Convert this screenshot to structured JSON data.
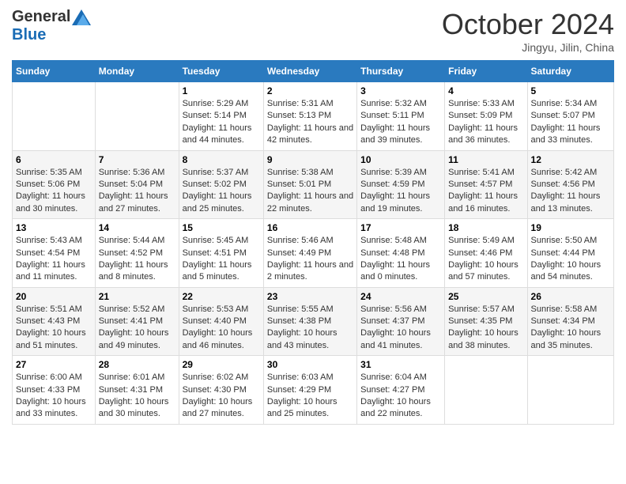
{
  "header": {
    "logo_general": "General",
    "logo_blue": "Blue",
    "month_title": "October 2024",
    "location": "Jingyu, Jilin, China"
  },
  "weekdays": [
    "Sunday",
    "Monday",
    "Tuesday",
    "Wednesday",
    "Thursday",
    "Friday",
    "Saturday"
  ],
  "weeks": [
    [
      {
        "day": "",
        "info": ""
      },
      {
        "day": "",
        "info": ""
      },
      {
        "day": "1",
        "sunrise": "Sunrise: 5:29 AM",
        "sunset": "Sunset: 5:14 PM",
        "daylight": "Daylight: 11 hours and 44 minutes."
      },
      {
        "day": "2",
        "sunrise": "Sunrise: 5:31 AM",
        "sunset": "Sunset: 5:13 PM",
        "daylight": "Daylight: 11 hours and 42 minutes."
      },
      {
        "day": "3",
        "sunrise": "Sunrise: 5:32 AM",
        "sunset": "Sunset: 5:11 PM",
        "daylight": "Daylight: 11 hours and 39 minutes."
      },
      {
        "day": "4",
        "sunrise": "Sunrise: 5:33 AM",
        "sunset": "Sunset: 5:09 PM",
        "daylight": "Daylight: 11 hours and 36 minutes."
      },
      {
        "day": "5",
        "sunrise": "Sunrise: 5:34 AM",
        "sunset": "Sunset: 5:07 PM",
        "daylight": "Daylight: 11 hours and 33 minutes."
      }
    ],
    [
      {
        "day": "6",
        "sunrise": "Sunrise: 5:35 AM",
        "sunset": "Sunset: 5:06 PM",
        "daylight": "Daylight: 11 hours and 30 minutes."
      },
      {
        "day": "7",
        "sunrise": "Sunrise: 5:36 AM",
        "sunset": "Sunset: 5:04 PM",
        "daylight": "Daylight: 11 hours and 27 minutes."
      },
      {
        "day": "8",
        "sunrise": "Sunrise: 5:37 AM",
        "sunset": "Sunset: 5:02 PM",
        "daylight": "Daylight: 11 hours and 25 minutes."
      },
      {
        "day": "9",
        "sunrise": "Sunrise: 5:38 AM",
        "sunset": "Sunset: 5:01 PM",
        "daylight": "Daylight: 11 hours and 22 minutes."
      },
      {
        "day": "10",
        "sunrise": "Sunrise: 5:39 AM",
        "sunset": "Sunset: 4:59 PM",
        "daylight": "Daylight: 11 hours and 19 minutes."
      },
      {
        "day": "11",
        "sunrise": "Sunrise: 5:41 AM",
        "sunset": "Sunset: 4:57 PM",
        "daylight": "Daylight: 11 hours and 16 minutes."
      },
      {
        "day": "12",
        "sunrise": "Sunrise: 5:42 AM",
        "sunset": "Sunset: 4:56 PM",
        "daylight": "Daylight: 11 hours and 13 minutes."
      }
    ],
    [
      {
        "day": "13",
        "sunrise": "Sunrise: 5:43 AM",
        "sunset": "Sunset: 4:54 PM",
        "daylight": "Daylight: 11 hours and 11 minutes."
      },
      {
        "day": "14",
        "sunrise": "Sunrise: 5:44 AM",
        "sunset": "Sunset: 4:52 PM",
        "daylight": "Daylight: 11 hours and 8 minutes."
      },
      {
        "day": "15",
        "sunrise": "Sunrise: 5:45 AM",
        "sunset": "Sunset: 4:51 PM",
        "daylight": "Daylight: 11 hours and 5 minutes."
      },
      {
        "day": "16",
        "sunrise": "Sunrise: 5:46 AM",
        "sunset": "Sunset: 4:49 PM",
        "daylight": "Daylight: 11 hours and 2 minutes."
      },
      {
        "day": "17",
        "sunrise": "Sunrise: 5:48 AM",
        "sunset": "Sunset: 4:48 PM",
        "daylight": "Daylight: 11 hours and 0 minutes."
      },
      {
        "day": "18",
        "sunrise": "Sunrise: 5:49 AM",
        "sunset": "Sunset: 4:46 PM",
        "daylight": "Daylight: 10 hours and 57 minutes."
      },
      {
        "day": "19",
        "sunrise": "Sunrise: 5:50 AM",
        "sunset": "Sunset: 4:44 PM",
        "daylight": "Daylight: 10 hours and 54 minutes."
      }
    ],
    [
      {
        "day": "20",
        "sunrise": "Sunrise: 5:51 AM",
        "sunset": "Sunset: 4:43 PM",
        "daylight": "Daylight: 10 hours and 51 minutes."
      },
      {
        "day": "21",
        "sunrise": "Sunrise: 5:52 AM",
        "sunset": "Sunset: 4:41 PM",
        "daylight": "Daylight: 10 hours and 49 minutes."
      },
      {
        "day": "22",
        "sunrise": "Sunrise: 5:53 AM",
        "sunset": "Sunset: 4:40 PM",
        "daylight": "Daylight: 10 hours and 46 minutes."
      },
      {
        "day": "23",
        "sunrise": "Sunrise: 5:55 AM",
        "sunset": "Sunset: 4:38 PM",
        "daylight": "Daylight: 10 hours and 43 minutes."
      },
      {
        "day": "24",
        "sunrise": "Sunrise: 5:56 AM",
        "sunset": "Sunset: 4:37 PM",
        "daylight": "Daylight: 10 hours and 41 minutes."
      },
      {
        "day": "25",
        "sunrise": "Sunrise: 5:57 AM",
        "sunset": "Sunset: 4:35 PM",
        "daylight": "Daylight: 10 hours and 38 minutes."
      },
      {
        "day": "26",
        "sunrise": "Sunrise: 5:58 AM",
        "sunset": "Sunset: 4:34 PM",
        "daylight": "Daylight: 10 hours and 35 minutes."
      }
    ],
    [
      {
        "day": "27",
        "sunrise": "Sunrise: 6:00 AM",
        "sunset": "Sunset: 4:33 PM",
        "daylight": "Daylight: 10 hours and 33 minutes."
      },
      {
        "day": "28",
        "sunrise": "Sunrise: 6:01 AM",
        "sunset": "Sunset: 4:31 PM",
        "daylight": "Daylight: 10 hours and 30 minutes."
      },
      {
        "day": "29",
        "sunrise": "Sunrise: 6:02 AM",
        "sunset": "Sunset: 4:30 PM",
        "daylight": "Daylight: 10 hours and 27 minutes."
      },
      {
        "day": "30",
        "sunrise": "Sunrise: 6:03 AM",
        "sunset": "Sunset: 4:29 PM",
        "daylight": "Daylight: 10 hours and 25 minutes."
      },
      {
        "day": "31",
        "sunrise": "Sunrise: 6:04 AM",
        "sunset": "Sunset: 4:27 PM",
        "daylight": "Daylight: 10 hours and 22 minutes."
      },
      {
        "day": "",
        "info": ""
      },
      {
        "day": "",
        "info": ""
      }
    ]
  ]
}
